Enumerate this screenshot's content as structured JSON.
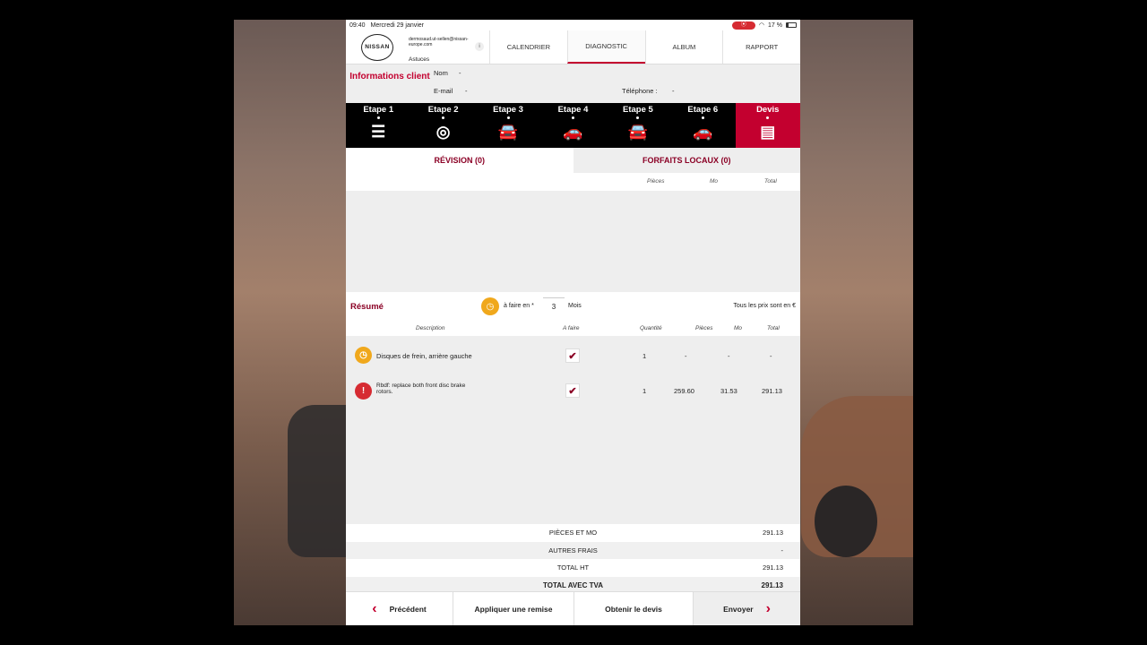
{
  "status": {
    "time": "09:40",
    "date": "Mercredi 29 janvier",
    "battery": "17 %"
  },
  "header": {
    "logo_text": "NISSAN",
    "user_email": "dermosaud.ut-sellen@nissan-europe.com",
    "tips": "Astuces",
    "info": "i",
    "nav": [
      "CALENDRIER",
      "DIAGNOSTIC",
      "ALBUM",
      "RAPPORT"
    ]
  },
  "client": {
    "title": "Informations client",
    "name_label": "Nom",
    "name_value": "-",
    "email_label": "E-mail",
    "email_value": "-",
    "phone_label": "Téléphone :",
    "phone_value": "-"
  },
  "steps": [
    "Etape 1",
    "Etape 2",
    "Etape 3",
    "Etape 4",
    "Etape 5",
    "Etape 6",
    "Devis"
  ],
  "tabs": {
    "revision": "RÉVISION (0)",
    "forfaits": "FORFAITS LOCAUX (0)"
  },
  "top_cols": {
    "pieces": "Pièces",
    "mo": "Mo",
    "total": "Total"
  },
  "resume": {
    "title": "Résumé",
    "afaire_label": "à faire en *",
    "months": "3",
    "mois": "Mois",
    "prices_note": "Tous les prix sont en €",
    "cols": {
      "description": "Description",
      "afaire": "A faire",
      "quantite": "Quantité",
      "pieces": "Pièces",
      "mo": "Mo",
      "total": "Total"
    },
    "rows": [
      {
        "desc": "Disques de frein, arrière gauche",
        "qty": "1",
        "pieces": "-",
        "mo": "-",
        "total": "-",
        "status_color": "#f0a81c"
      },
      {
        "desc": "Rbdf: replace both front disc brake rotors.",
        "qty": "1",
        "pieces": "259.60",
        "mo": "31.53",
        "total": "291.13",
        "status_color": "#d62b32"
      }
    ]
  },
  "totals": [
    {
      "label": "PIÈCES ET MO",
      "value": "291.13"
    },
    {
      "label": "AUTRES FRAIS",
      "value": "-"
    },
    {
      "label": "TOTAL HT",
      "value": "291.13"
    },
    {
      "label": "TOTAL AVEC TVA",
      "value": "291.13"
    }
  ],
  "footer": {
    "prev": "Précédent",
    "discount": "Appliquer une remise",
    "get_quote": "Obtenir le devis",
    "send": "Envoyer"
  },
  "colors": {
    "accent": "#c3002f",
    "dark_red": "#8b0025"
  }
}
